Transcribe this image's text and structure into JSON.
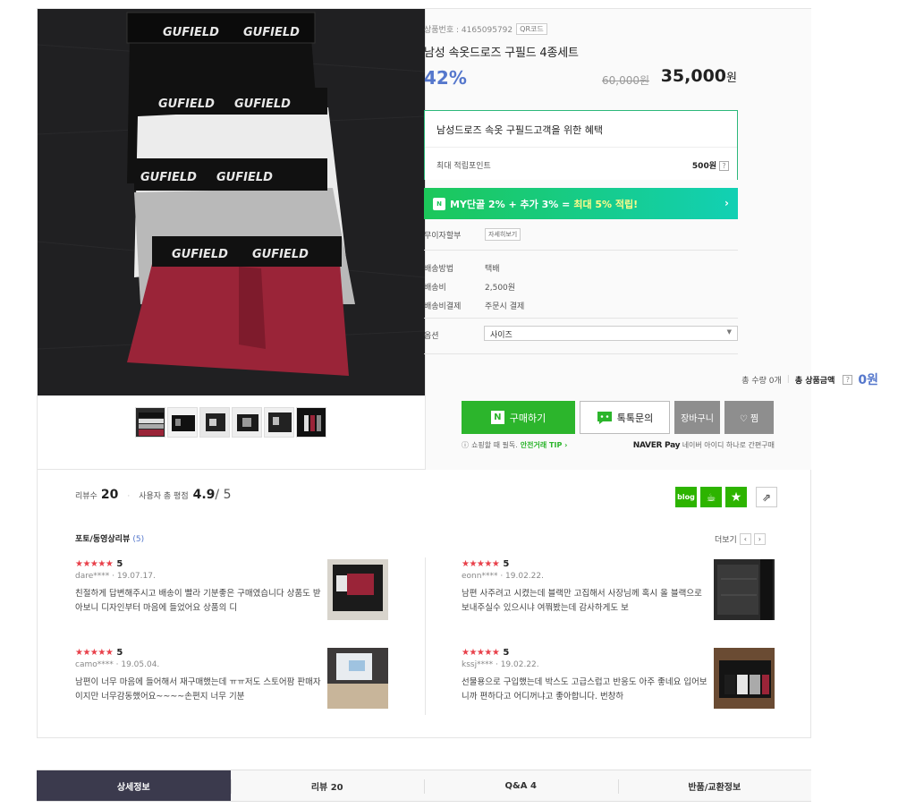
{
  "product": {
    "number_label": "상품번호 : 4165095792",
    "qr_label": "QR코드",
    "title": "남성 속옷드로즈 구필드 4종세트",
    "discount_rate": "42%",
    "original_price": "60,000원",
    "sale_price": "35,000",
    "sale_unit": "원",
    "brand_text": "GUFIELD"
  },
  "benefit": {
    "title": "남성드로즈 속옷 구필드고객을 위한 혜택",
    "points_label": "최대 적립포인트",
    "points_value": "500원",
    "help": "?"
  },
  "my_banner": {
    "badge": "N",
    "text_main": "MY단골 2% + 추가 3% = ",
    "text_highlight": "최대 5% 적립!",
    "arrow": "›"
  },
  "installment": {
    "label": "무이자할부",
    "button": "자세히보기"
  },
  "shipping": {
    "method_label": "배송방법",
    "method_value": "택배",
    "fee_label": "배송비",
    "fee_value": "2,500원",
    "pay_label": "배송비결제",
    "pay_value": "주문시 결제"
  },
  "option": {
    "label": "옵션",
    "selected": "사이즈",
    "caret": "▼"
  },
  "total": {
    "qty_label": "총 수량 0개",
    "sum_label": "총 상품금액",
    "help": "?",
    "sum_value": "0원"
  },
  "buttons": {
    "buy_icon": "N",
    "buy": "구매하기",
    "talk": "톡톡문의",
    "cart": "장바구니",
    "zzim": "♡ 찜"
  },
  "tip": {
    "icon": "ⓘ",
    "text": "쇼핑할 때 필독.",
    "link": "안전거래 TIP ›"
  },
  "naverpay": {
    "brand": "NAVER Pay",
    "text": "네이버 아이디 하나로 간편구매"
  },
  "reviews": {
    "count_label": "리뷰수",
    "count": "20",
    "avg_label": "사용자 총 평점",
    "avg": "4.9",
    "outof": "/ 5",
    "photo_header": "포토/동영상리뷰",
    "photo_count": "(5)",
    "more": "더보기",
    "prev": "‹",
    "next": "›",
    "social": {
      "blog": "blog",
      "cafe": "☕",
      "star": "★",
      "share": "⇗"
    },
    "items": [
      {
        "stars": "★★★★★",
        "score": "5",
        "user": "dare****",
        "date": "19.07.17.",
        "text": "친절하게 답변해주시고 배송이 빨라 기분좋은 구매였습니다 상품도 받아보니 디자인부터 마음에 들었어요 상품의 디"
      },
      {
        "stars": "★★★★★",
        "score": "5",
        "user": "eonn****",
        "date": "19.02.22.",
        "text": "남편 사주려고 시켰는데 블랙만 고집해서 사장님께 혹시 올 블랙으로 보내주실수 있으시냐 여쭤봤는데 감사하게도 보"
      },
      {
        "stars": "★★★★★",
        "score": "5",
        "user": "camo****",
        "date": "19.05.04.",
        "text": "남편이 너무 마음에 들어해서 재구매했는데 ㅠㅠ저도 스토어팜 판매자이지만 너무감동했어요~~~~손편지 너무 기분"
      },
      {
        "stars": "★★★★★",
        "score": "5",
        "user": "kssj****",
        "date": "19.02.22.",
        "text": "선물용으로 구입했는데 박스도 고급스럽고 반응도 아주 좋네요 입어보니까 편하다고 어디꺼냐고 좋아합니다. 번창하"
      }
    ]
  },
  "tabs": [
    {
      "label": "상세정보"
    },
    {
      "label": "리뷰 20"
    },
    {
      "label": "Q&A 4"
    },
    {
      "label": "반품/교환정보"
    }
  ],
  "colors": {
    "accent_blue": "#5577cc",
    "naver_green": "#2cb52c",
    "star_red": "#e8404a",
    "tab_dark": "#3b3a4d"
  }
}
